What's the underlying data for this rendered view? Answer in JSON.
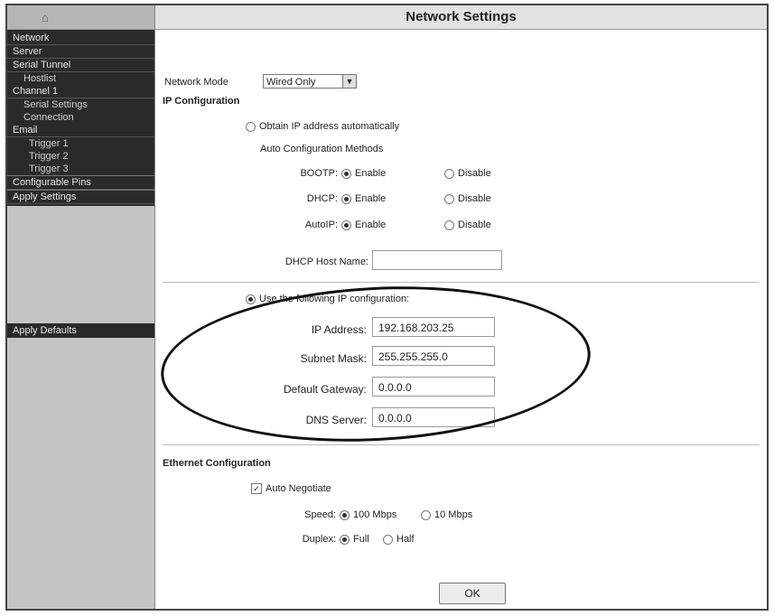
{
  "sidebar": {
    "home_icon": "home-icon",
    "menu": [
      {
        "label": "Network",
        "level": 0
      },
      {
        "label": "Server",
        "level": 0
      },
      {
        "label": "Serial Tunnel",
        "level": 0
      },
      {
        "label": "Hostlist",
        "level": 1
      },
      {
        "label": "Channel 1",
        "level": 0
      },
      {
        "label": "Serial Settings",
        "level": 1
      },
      {
        "label": "Connection",
        "level": 1
      },
      {
        "label": "Email",
        "level": 0
      },
      {
        "label": "Trigger 1",
        "level": 2
      },
      {
        "label": "Trigger 2",
        "level": 2
      },
      {
        "label": "Trigger 3",
        "level": 2
      },
      {
        "label": "Configurable Pins",
        "level": 0
      },
      {
        "label": "Apply Settings",
        "level": 0
      }
    ],
    "apply_defaults": "Apply Defaults"
  },
  "page": {
    "title": "Network Settings"
  },
  "network_mode": {
    "label": "Network Mode",
    "value": "Wired Only"
  },
  "ip_config": {
    "heading": "IP Configuration",
    "obtain_auto_label": "Obtain IP address automatically",
    "auto_methods_label": "Auto Configuration Methods",
    "methods": [
      {
        "name": "BOOTP:",
        "enable": "Enable",
        "disable": "Disable"
      },
      {
        "name": "DHCP:",
        "enable": "Enable",
        "disable": "Disable"
      },
      {
        "name": "AutoIP:",
        "enable": "Enable",
        "disable": "Disable"
      }
    ],
    "dhcp_host_label": "DHCP Host Name:",
    "dhcp_host_value": "",
    "use_following_label": "Use the following IP configuration:",
    "fields": [
      {
        "label": "IP Address:",
        "value": "192.168.203.25"
      },
      {
        "label": "Subnet Mask:",
        "value": "255.255.255.0"
      },
      {
        "label": "Default Gateway:",
        "value": "0.0.0.0"
      },
      {
        "label": "DNS Server:",
        "value": "0.0.0.0"
      }
    ]
  },
  "ethernet": {
    "heading": "Ethernet Configuration",
    "auto_negotiate": "Auto Negotiate",
    "speed_label": "Speed:",
    "speed_100": "100 Mbps",
    "speed_10": "10 Mbps",
    "duplex_label": "Duplex:",
    "duplex_full": "Full",
    "duplex_half": "Half"
  },
  "ok_button": "OK"
}
